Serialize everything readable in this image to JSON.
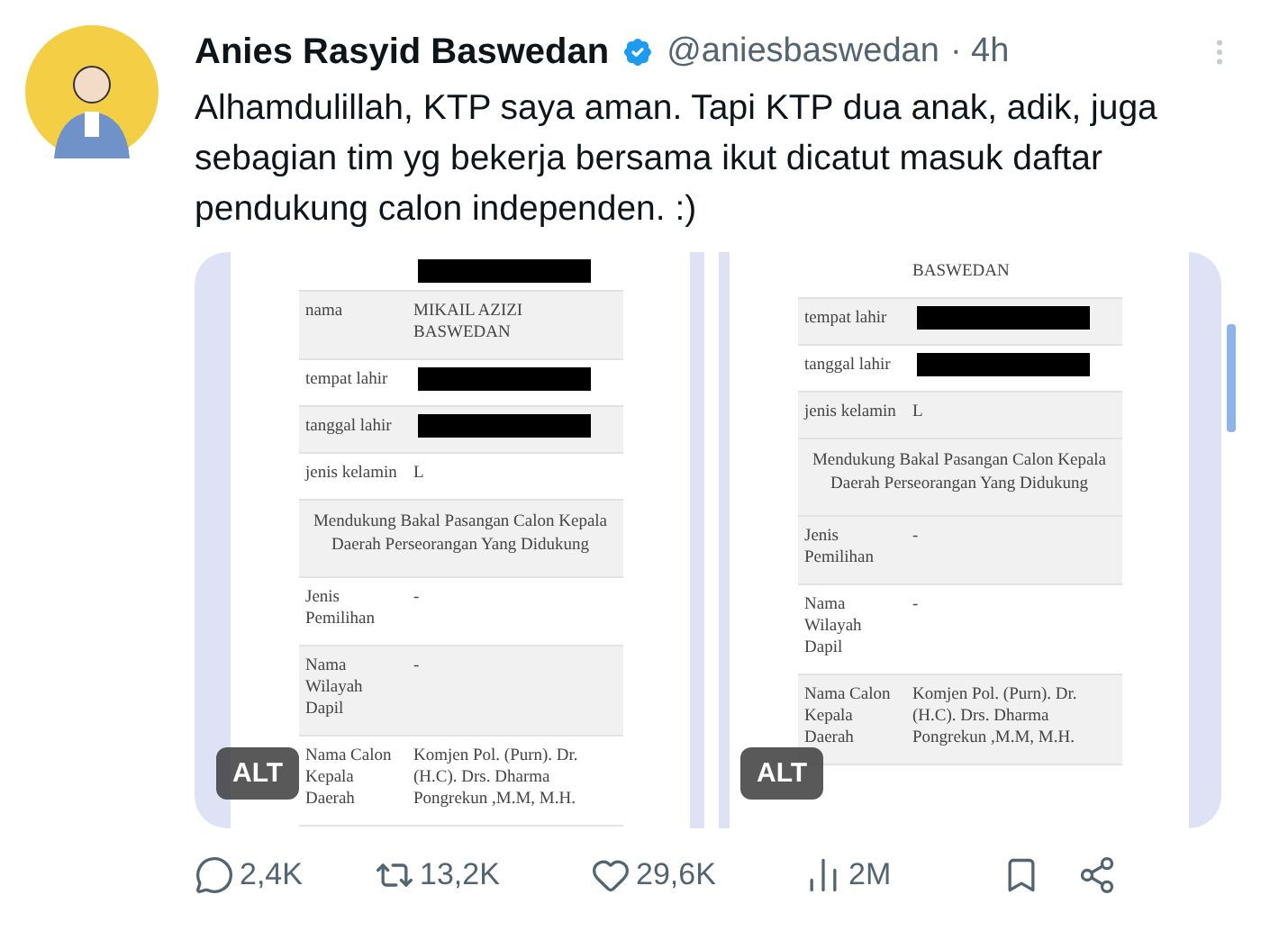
{
  "author": {
    "name": "Anies Rasyid Baswedan",
    "verified": true,
    "handle": "@aniesbaswedan",
    "time": "· 4h"
  },
  "text": "Alhamdulillah, KTP saya aman. Tapi KTP dua anak, adik, juga sebagian tim yg bekerja bersama ikut dicatut masuk daftar pendukung calon independen. :)",
  "images": [
    {
      "alt": "ALT",
      "rows": [
        {
          "kind": "redacted"
        },
        {
          "kind": "text",
          "label": "nama",
          "value": "MIKAIL AZIZI BASWEDAN"
        },
        {
          "kind": "redacted",
          "label": "tempat lahir"
        },
        {
          "kind": "redacted",
          "label": "tanggal lahir"
        },
        {
          "kind": "text",
          "label": "jenis kelamin",
          "value": "L"
        },
        {
          "kind": "heading",
          "value": "Mendukung Bakal Pasangan Calon Kepala Daerah Perseorangan Yang Didukung"
        },
        {
          "kind": "text",
          "label": "Jenis Pemilihan",
          "value": "-"
        },
        {
          "kind": "text",
          "label": "Nama Wilayah Dapil",
          "value": "-"
        },
        {
          "kind": "text",
          "label": "Nama Calon Kepala Daerah",
          "value": "Komjen Pol. (Purn). Dr. (H.C). Drs. Dharma Pongrekun ,M.M, M.H."
        }
      ]
    },
    {
      "alt": "ALT",
      "rows": [
        {
          "kind": "text",
          "value": "BASWEDAN"
        },
        {
          "kind": "redacted",
          "label": "tempat lahir"
        },
        {
          "kind": "redacted",
          "label": "tanggal lahir"
        },
        {
          "kind": "text",
          "label": "jenis kelamin",
          "value": "L"
        },
        {
          "kind": "heading",
          "value": "Mendukung Bakal Pasangan Calon Kepala Daerah Perseorangan Yang Didukung"
        },
        {
          "kind": "text",
          "label": "Jenis Pemilihan",
          "value": "-"
        },
        {
          "kind": "text",
          "label": "Nama Wilayah Dapil",
          "value": "-"
        },
        {
          "kind": "text",
          "label": "Nama Calon Kepala Daerah",
          "value": "Komjen Pol. (Purn). Dr. (H.C). Drs. Dharma Pongrekun ,M.M, M.H."
        }
      ]
    }
  ],
  "actions": [
    {
      "kind": "reply",
      "count": "2,4K"
    },
    {
      "kind": "repost",
      "count": "13,2K"
    },
    {
      "kind": "like",
      "count": "29,6K"
    },
    {
      "kind": "views",
      "count": "2M"
    },
    {
      "kind": "bookmark"
    },
    {
      "kind": "share"
    }
  ]
}
